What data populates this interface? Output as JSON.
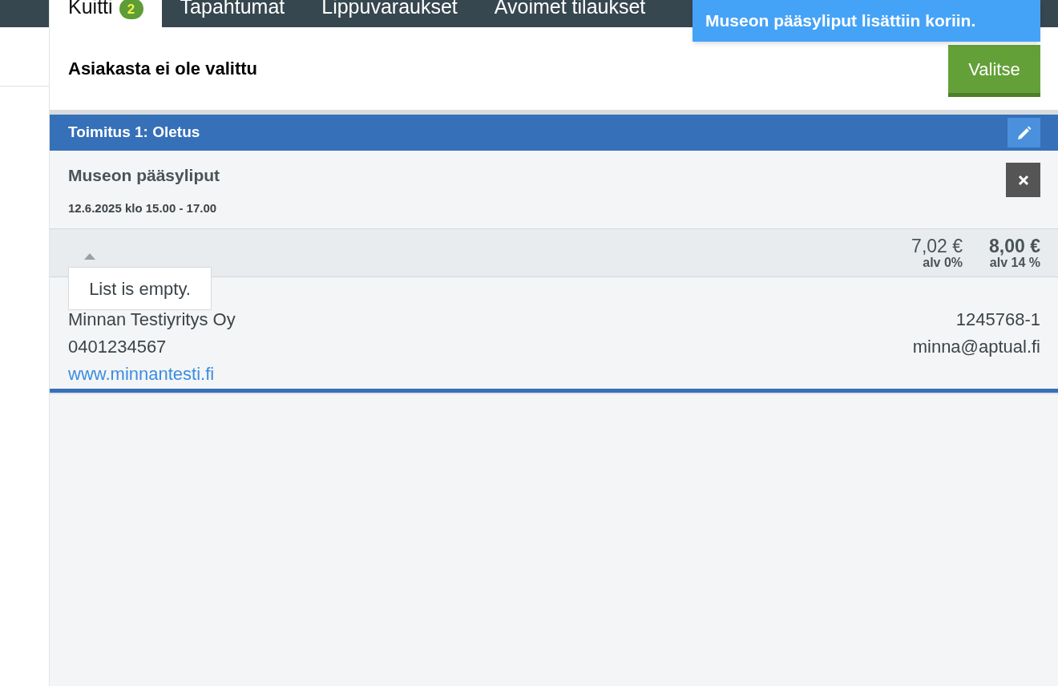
{
  "tabs": [
    {
      "label": "Kuitti",
      "badge": "2",
      "selected": true
    },
    {
      "label": "Tapahtumat",
      "selected": false
    },
    {
      "label": "Lippuvaraukset",
      "selected": false
    },
    {
      "label": "Avoimet tilaukset",
      "selected": false
    }
  ],
  "toast": "Museon pääsyliput lisättiin koriin.",
  "customer": {
    "title": "Asiakasta ei ole valittu",
    "button": "Valitse"
  },
  "delivery": {
    "title": "Toimitus 1: Oletus"
  },
  "item": {
    "name": "Museon pääsyliput",
    "date": "12.6.2025 klo 15.00 - 17.00"
  },
  "totals": [
    {
      "amount": "7,02 €",
      "vat": "alv 0%",
      "bold": false
    },
    {
      "amount": "8,00 €",
      "vat": "alv 14 %",
      "bold": true
    }
  ],
  "company": {
    "name": "Minnan Testiyritys Oy",
    "business_id": "1245768-1",
    "phone": "0401234567",
    "email": "minna@aptual.fi",
    "website": "www.minnantesti.fi"
  },
  "popup": "List is empty."
}
